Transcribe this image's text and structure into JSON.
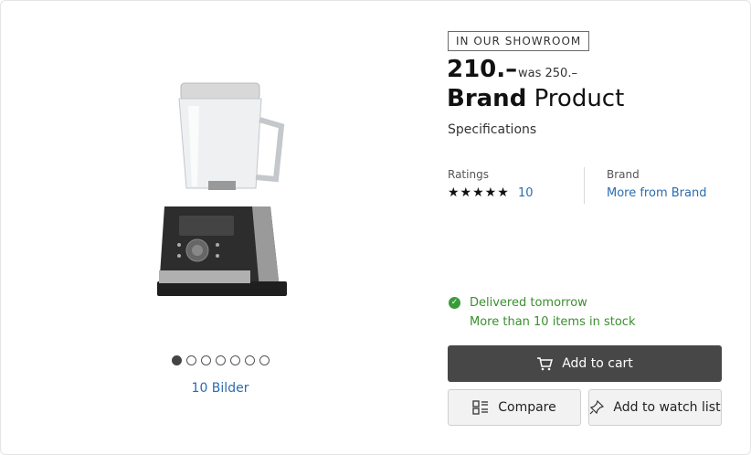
{
  "gallery": {
    "image_alt": "blender-product-image",
    "dots_count": 7,
    "active_dot": 0,
    "images_link": "10 Bilder"
  },
  "product": {
    "badge": "IN OUR SHOWROOM",
    "price": "210.–",
    "was_price": "was 250.–",
    "brand": "Brand",
    "name": "Product",
    "specifications_link": "Specifications"
  },
  "ratings": {
    "label": "Ratings",
    "stars": "★★★★★",
    "count": "10"
  },
  "brand_info": {
    "label": "Brand",
    "link": "More from Brand"
  },
  "availability": {
    "delivery": "Delivered tomorrow",
    "stock": "More than 10 items in stock",
    "color": "#3a8f2e"
  },
  "actions": {
    "add_to_cart": "Add to cart",
    "compare": "Compare",
    "watch_list": "Add to watch list"
  },
  "colors": {
    "link": "#2b6cb0",
    "primary_button": "#474747"
  }
}
